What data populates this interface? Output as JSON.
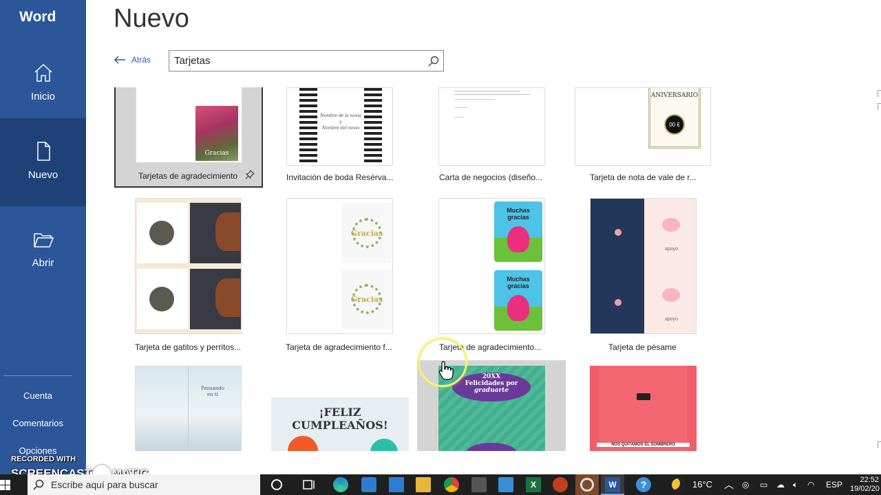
{
  "app": {
    "name": "Word"
  },
  "sidebar": {
    "nav": [
      {
        "label": "Inicio",
        "icon": "home-icon"
      },
      {
        "label": "Nuevo",
        "icon": "new-document-icon",
        "active": true
      },
      {
        "label": "Abrir",
        "icon": "folder-open-icon"
      }
    ],
    "links": [
      "Cuenta",
      "Comentarios",
      "Opciones"
    ]
  },
  "header": {
    "title": "Nuevo",
    "back_label": "Atrás"
  },
  "search": {
    "value": "Tarjetas",
    "icon": "search-icon"
  },
  "templates": [
    {
      "label": "Tarjetas de agradecimiento",
      "selected": true,
      "pin_icon": "pin-icon",
      "thumb_text": "Gracias"
    },
    {
      "label": "Invitación de boda Resérva...",
      "thumb_text_1": "Nombre de la novia",
      "thumb_text_2": "y",
      "thumb_text_3": "Nombre del novio"
    },
    {
      "label": "Carta de negocios (diseño..."
    },
    {
      "label": "Tarjeta de nota de vale de r...",
      "thumb_title": "ANIVERSARIO",
      "thumb_value": "00 €"
    },
    {
      "label": "Tarjeta de gatitos y perritos..."
    },
    {
      "label": "Tarjeta de agradecimiento f...",
      "thumb_text": "Gracias"
    },
    {
      "label": "Tarjeta de agradecimiento...",
      "thumb_text_1": "Muchas",
      "thumb_text_2": "gracias"
    },
    {
      "label": "Tarjeta de pésame",
      "thumb_text": "apoyo"
    },
    {
      "label": "",
      "thumb_text_1": "Pensando",
      "thumb_text_2": "en ti"
    },
    {
      "label": "",
      "thumb_text": "¡FELIZ CUMPLEAÑOS!"
    },
    {
      "label": "",
      "thumb_text_1": "20XX",
      "thumb_text_2": "Felicidades por",
      "thumb_text_3": "graduarte"
    },
    {
      "label": "",
      "thumb_text": "NOS QUITAMOS EL SOMBRERO"
    }
  ],
  "watermark": {
    "line1": "RECORDED WITH",
    "line2a": "SCREENCAST",
    "line2b": "MATIC"
  },
  "taskbar": {
    "search_placeholder": "Escribe aquí para buscar",
    "weather": "16°C",
    "language": "ESP",
    "time": "22:52",
    "date": "19/02/20"
  }
}
